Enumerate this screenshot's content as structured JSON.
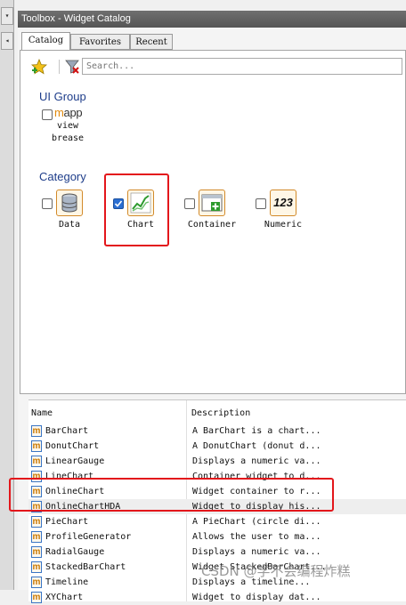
{
  "window": {
    "title": "Toolbox - Widget Catalog"
  },
  "tabs": [
    {
      "label": "Catalog",
      "active": true
    },
    {
      "label": "Favorites",
      "active": false
    },
    {
      "label": "Recent",
      "active": false
    }
  ],
  "toolbar": {
    "icons": [
      "favorite-star-icon",
      "filter-clear-icon"
    ],
    "search_placeholder": "Search..."
  },
  "ui_group": {
    "title": "UI Group",
    "items": [
      {
        "logo": "mapp",
        "label_line1": "view",
        "label_line2": "brease",
        "checked": false
      }
    ]
  },
  "category": {
    "title": "Category",
    "items": [
      {
        "label": "Data",
        "icon": "database-icon",
        "checked": false
      },
      {
        "label": "Chart",
        "icon": "chart-icon",
        "checked": true
      },
      {
        "label": "Container",
        "icon": "container-add-icon",
        "checked": false
      },
      {
        "label": "Numeric",
        "icon": "numeric-123-icon",
        "icon_text": "123",
        "checked": false
      }
    ]
  },
  "widget_list": {
    "columns": [
      "Name",
      "Description"
    ],
    "rows": [
      {
        "name": "BarChart",
        "description": "A BarChart is a chart..."
      },
      {
        "name": "DonutChart",
        "description": "A DonutChart (donut d..."
      },
      {
        "name": "LinearGauge",
        "description": "Displays a numeric va..."
      },
      {
        "name": "LineChart",
        "description": "Container widget to d..."
      },
      {
        "name": "OnlineChart",
        "description": "Widget container to r..."
      },
      {
        "name": "OnlineChartHDA",
        "description": "Widget to display his..."
      },
      {
        "name": "PieChart",
        "description": "A PieChart (circle di..."
      },
      {
        "name": "ProfileGenerator",
        "description": "Allows the user to ma..."
      },
      {
        "name": "RadialGauge",
        "description": "Displays a numeric va..."
      },
      {
        "name": "StackedBarChart",
        "description": "Widget StackedBarChart..."
      },
      {
        "name": "Timeline",
        "description": "Displays a timeline..."
      },
      {
        "name": "XYChart",
        "description": "Widget to display dat..."
      }
    ],
    "selected_row": "OnlineChartHDA",
    "item_icon_letter": "m"
  },
  "watermark": "CSDN @学不会编程炸糕",
  "colors": {
    "accent": "#1e3d8a",
    "annotation": "#e3161b",
    "icon_orange": "#e28a0b"
  }
}
